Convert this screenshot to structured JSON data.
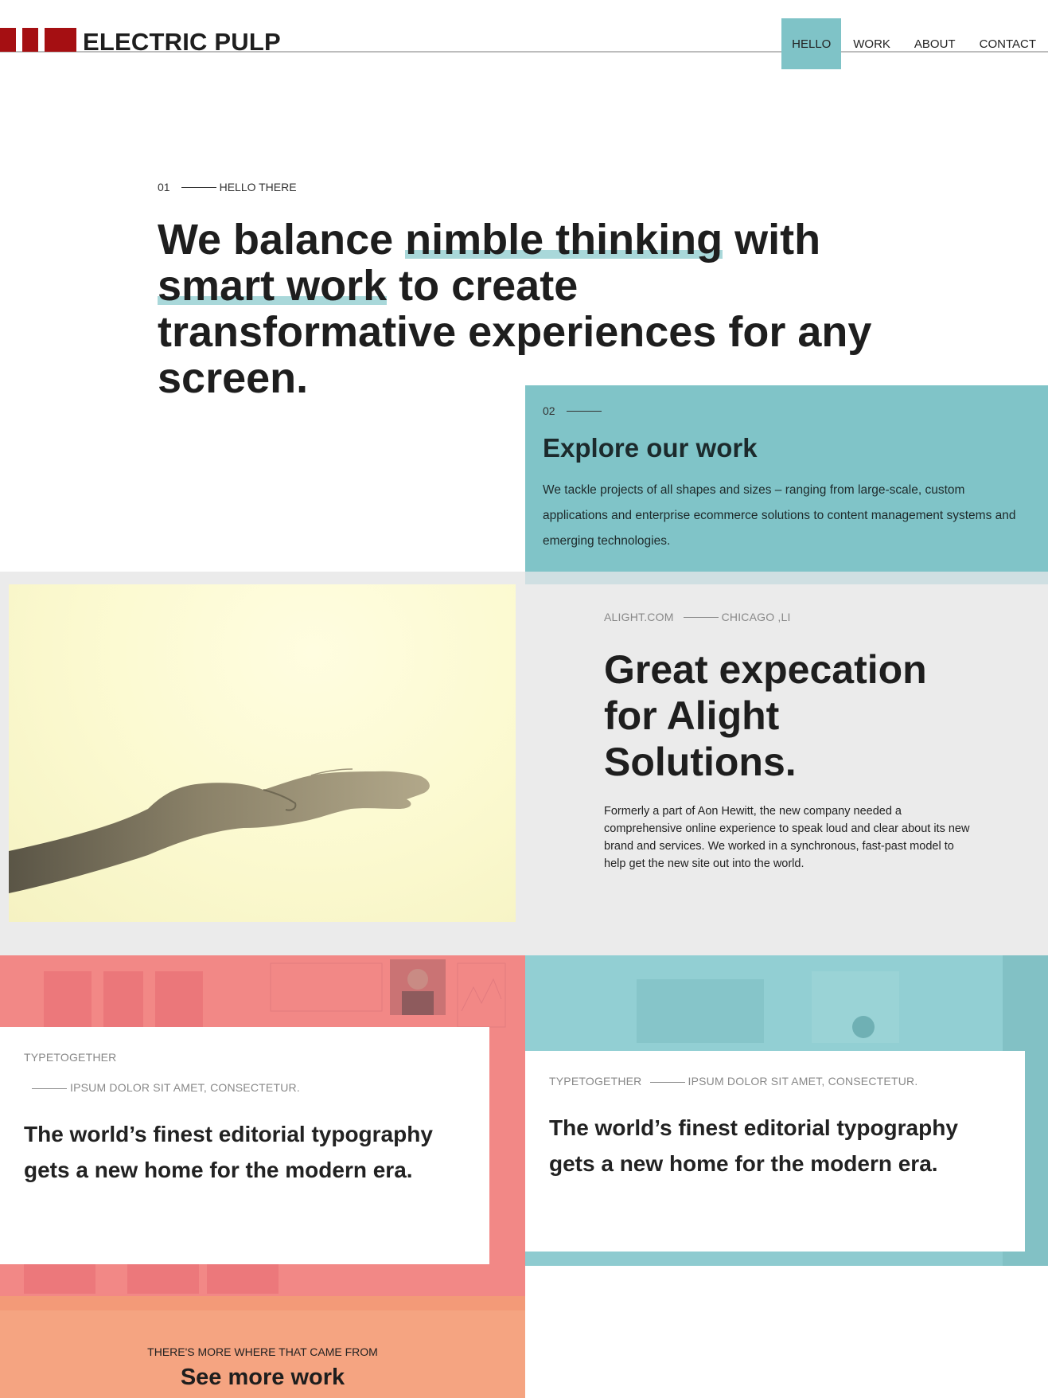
{
  "brand": {
    "name": "ELECTRIC PULP",
    "color": "#a50f12"
  },
  "nav": [
    {
      "label": "HELLO",
      "active": true
    },
    {
      "label": "WORK"
    },
    {
      "label": "ABOUT"
    },
    {
      "label": "CONTACT"
    }
  ],
  "hero": {
    "number": "01",
    "eyebrow": "HELLO THERE",
    "title_1": "We balance ",
    "title_hl_1": "nimble thinking",
    "title_2": " with ",
    "title_hl_2": "smart work",
    "title_3": " to create transformative experiences for any screen."
  },
  "explore": {
    "number": "02",
    "title": "Explore our work",
    "text": "We tackle projects of all shapes and sizes – ranging from large-scale, custom applications and enterprise ecommerce solutions to content management systems and emerging technologies."
  },
  "feature": {
    "client": "ALIGHT.COM",
    "location": "CHICAGO ,LI",
    "title": "Great expecation for Alight Solutions.",
    "description": "Formerly a part of Aon Hewitt, the new company needed a comprehensive online experience to speak loud and clear about its new brand and services. We worked in a synchronous, fast-past model to help get the new site out into the world."
  },
  "cards": [
    {
      "client": "TYPETOGETHER",
      "tagline": "IPSUM DOLOR SIT AMET, CONSECTETUR.",
      "title": "The world’s finest editorial typography gets a new home for the modern era."
    },
    {
      "client": "TYPETOGETHER",
      "tagline": "IPSUM DOLOR SIT AMET, CONSECTETUR.",
      "title": "The world’s finest editorial typography gets a new home for the modern era."
    }
  ],
  "more": {
    "kicker": "THERE'S MORE WHERE THAT CAME FROM",
    "title": "See more work"
  },
  "colors": {
    "teal": "#80c4c8",
    "coral": "#f28886",
    "orange": "#f5a481",
    "grey": "#ebebeb"
  }
}
